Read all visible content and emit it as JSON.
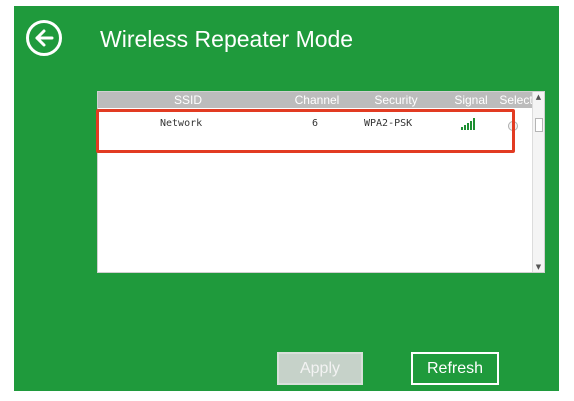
{
  "header": {
    "title": "Wireless Repeater Mode",
    "back_icon": "back-arrow-circle-icon"
  },
  "table": {
    "columns": [
      "SSID",
      "Channel",
      "Security",
      "Signal",
      "Select"
    ],
    "rows": [
      {
        "ssid": "Network",
        "channel": "6",
        "security": "WPA2-PSK",
        "signal_icon": "signal-bars-icon",
        "selected": false
      }
    ],
    "highlight_color": "#e23b22"
  },
  "buttons": {
    "apply_label": "Apply",
    "refresh_label": "Refresh"
  },
  "colors": {
    "background": "#1f9a3c",
    "header_bg": "#bcbcbc",
    "signal": "#1d8f32"
  }
}
